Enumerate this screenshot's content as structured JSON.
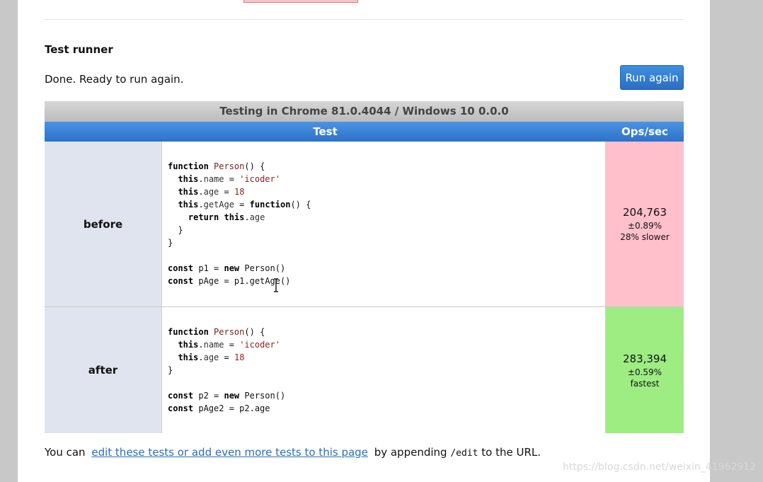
{
  "runner": {
    "heading": "Test runner",
    "status": "Done. Ready to run again.",
    "run_button": "Run again"
  },
  "table": {
    "env_header": "Testing in Chrome 81.0.4044 / Windows 10 0.0.0",
    "col_test": "Test",
    "col_ops": "Ops/sec",
    "rows": [
      {
        "label": "before",
        "ops": "204,763",
        "error": "±0.89%",
        "note": "28% slower",
        "color": "#ffc0cb"
      },
      {
        "label": "after",
        "ops": "283,394",
        "error": "±0.59%",
        "note": "fastest",
        "color": "#9ded83"
      }
    ]
  },
  "footer": {
    "prefix": "You can",
    "link": "edit these tests or add even more tests to this page",
    "middle": "by appending",
    "code": "/edit",
    "suffix": "to the URL."
  },
  "watermark": "https://blog.csdn.net/weixin_41962912"
}
